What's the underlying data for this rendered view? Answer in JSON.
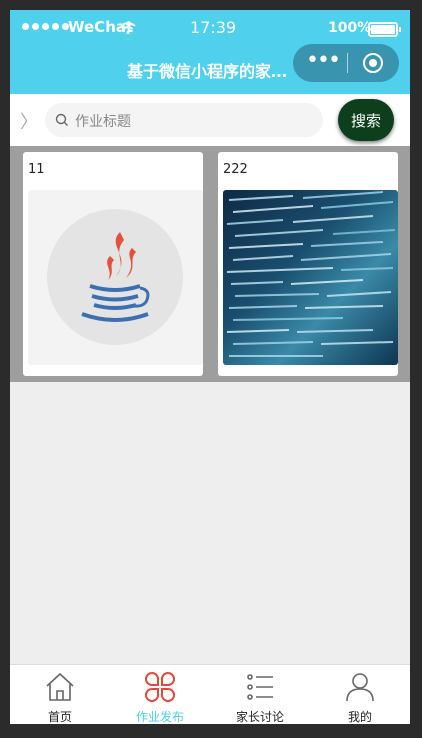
{
  "status_bar": {
    "carrier": "WeChat",
    "time": "17:39",
    "battery": "100%"
  },
  "nav": {
    "title": "基于微信小程序的家…"
  },
  "search": {
    "placeholder": "作业标题",
    "button_label": "搜索"
  },
  "cards": [
    {
      "title": "11",
      "image": "java-logo"
    },
    {
      "title": "222",
      "image": "code-screen-photo"
    }
  ],
  "tabs": [
    {
      "label": "首页",
      "icon": "home-icon",
      "active": false
    },
    {
      "label": "作业发布",
      "icon": "clover-icon",
      "active": true
    },
    {
      "label": "家长讨论",
      "icon": "list-icon",
      "active": false
    },
    {
      "label": "我的",
      "icon": "user-icon",
      "active": false
    }
  ],
  "colors": {
    "accent": "#4fd0ec",
    "search_button": "#0d3f1c",
    "active_icon": "#e24a3b"
  }
}
